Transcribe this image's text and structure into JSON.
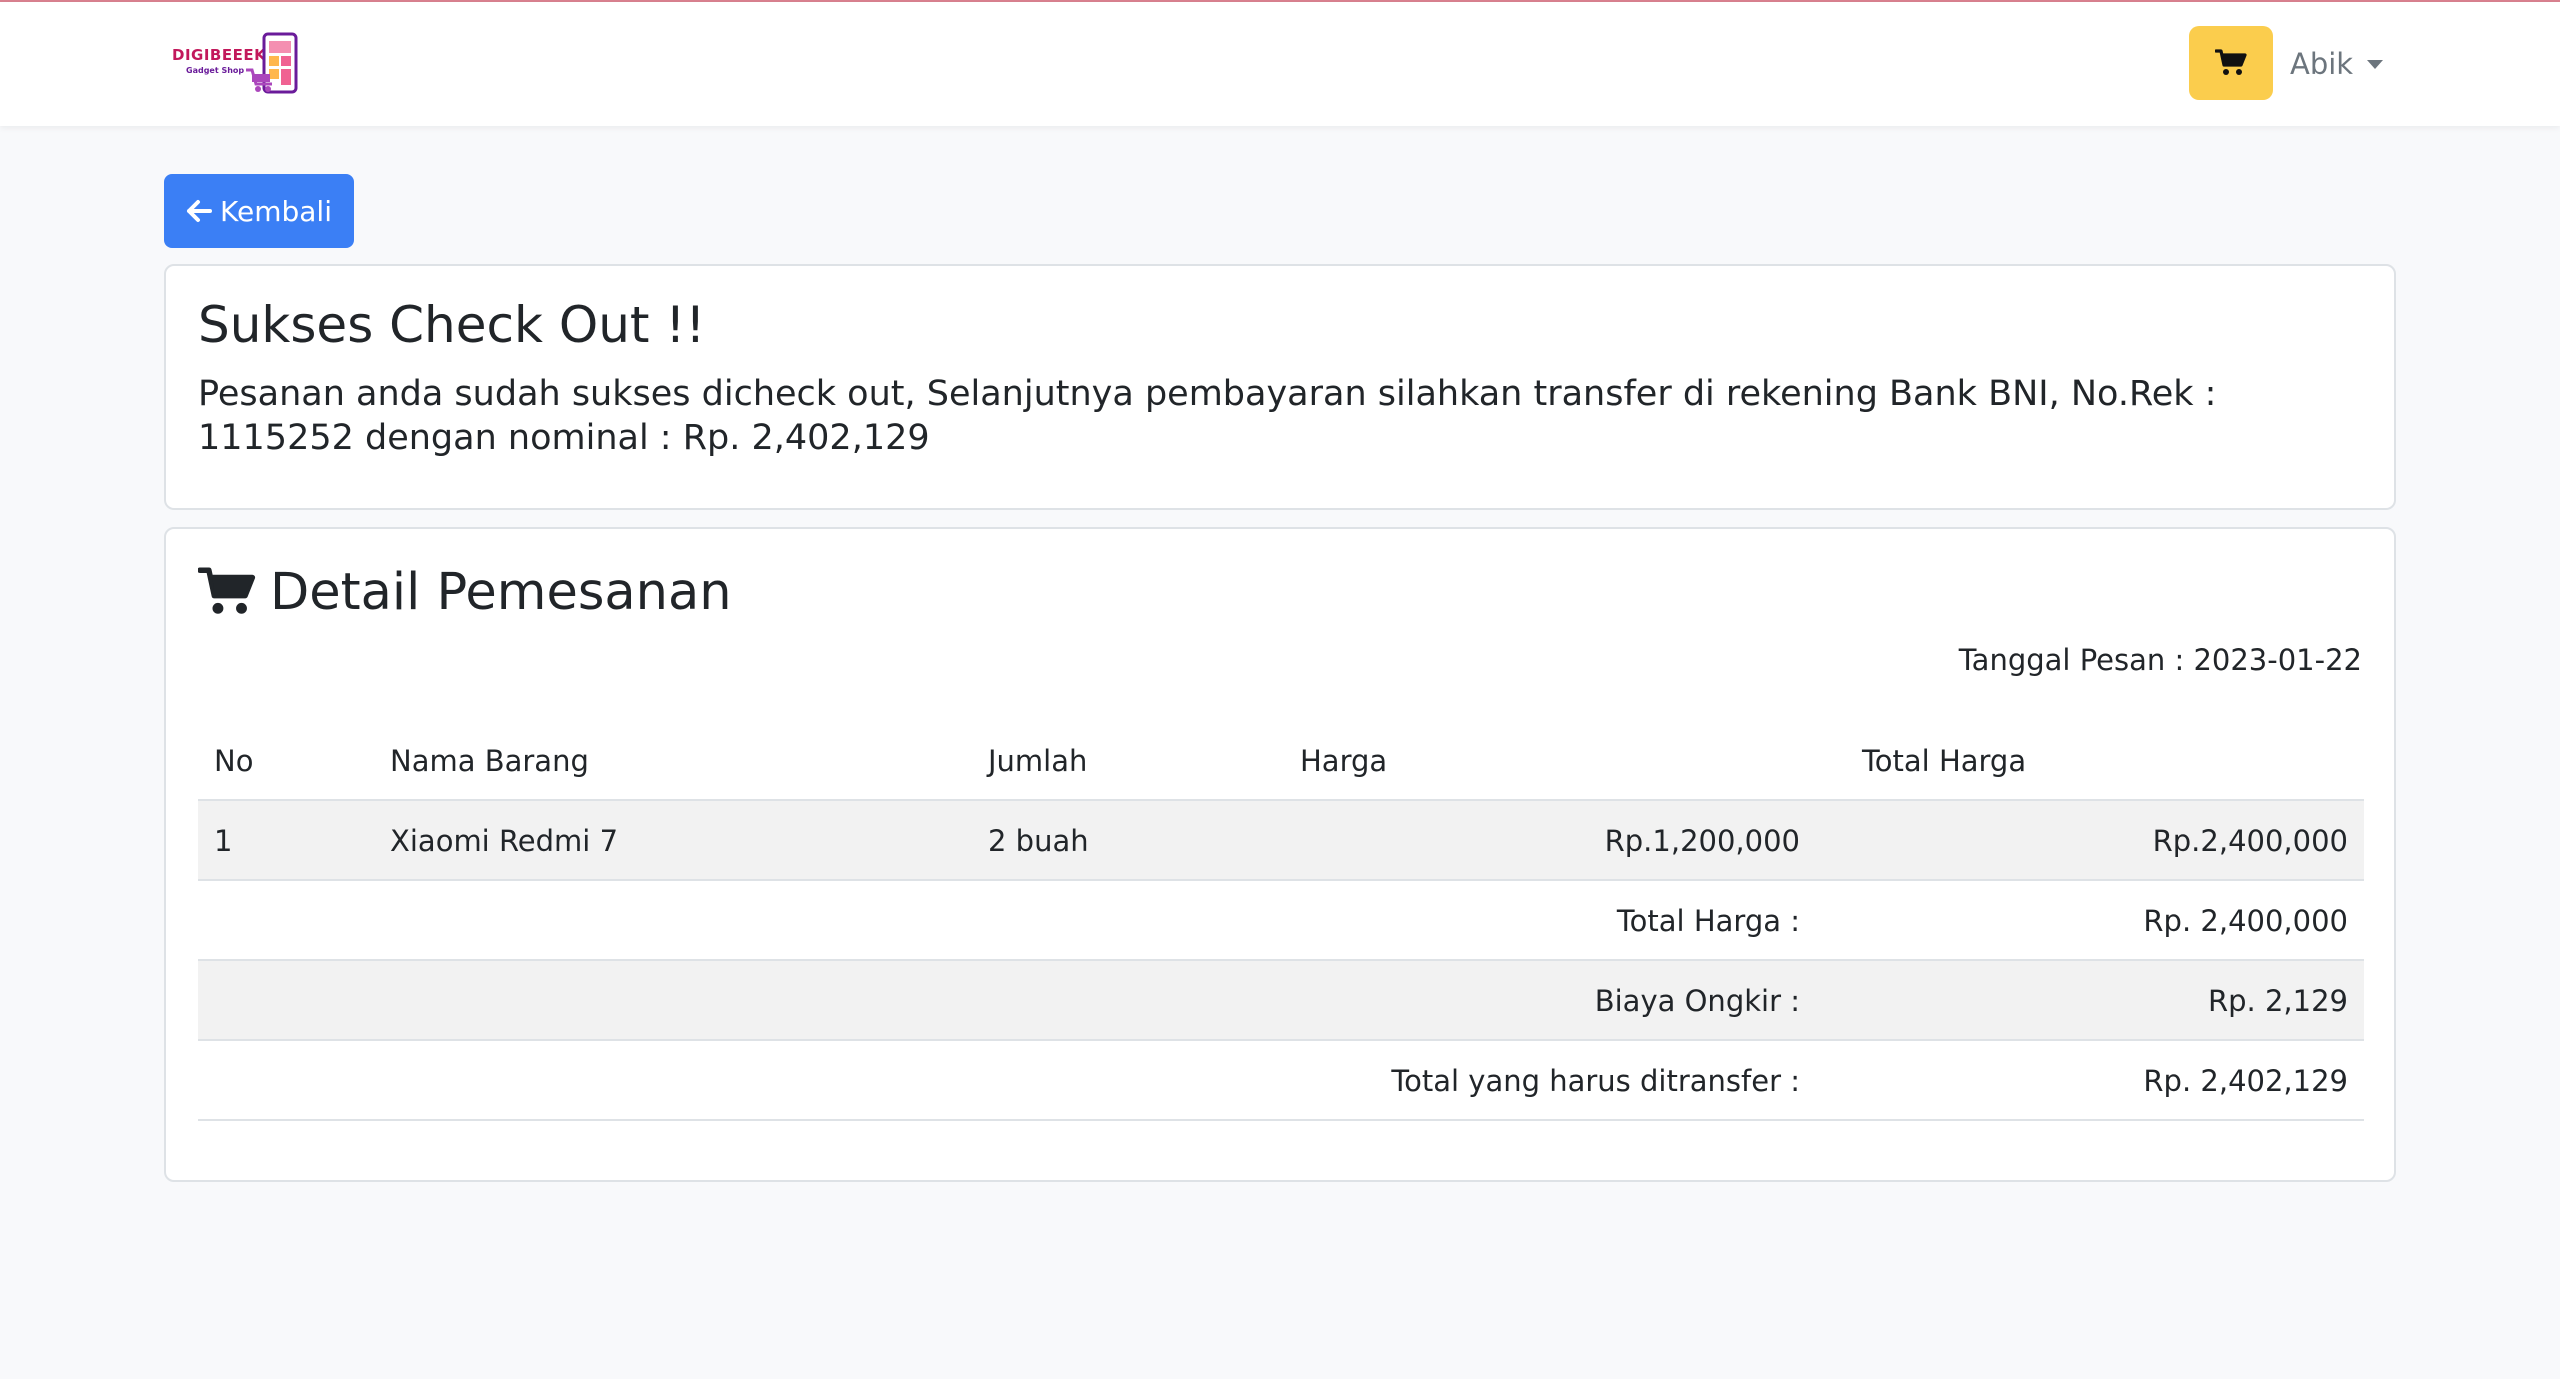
{
  "header": {
    "logo": {
      "brand": "DIGIBEEEK",
      "tagline": "Gadget Shop"
    },
    "cart_icon": "cart-icon",
    "user_name": "Abik"
  },
  "back_button": {
    "label": "Kembali",
    "icon": "arrow-left-icon"
  },
  "success_card": {
    "title": "Sukses Check Out !!",
    "message": "Pesanan anda sudah sukses dicheck out, Selanjutnya pembayaran silahkan transfer di rekening Bank BNI, No.Rek : 1115252 dengan nominal : Rp. 2,402,129"
  },
  "detail_card": {
    "title": "Detail Pemesanan",
    "icon": "cart-icon",
    "order_date": "Tanggal Pesan : 2023-01-22",
    "table": {
      "headers": {
        "no": "No",
        "name": "Nama Barang",
        "qty": "Jumlah",
        "price": "Harga",
        "total": "Total Harga"
      },
      "items": [
        {
          "no": "1",
          "name": "Xiaomi Redmi 7",
          "qty": "2 buah",
          "price": "Rp.1,200,000",
          "total": "Rp.2,400,000"
        }
      ],
      "summary": [
        {
          "label": "Total Harga :",
          "value": "Rp. 2,400,000"
        },
        {
          "label": "Biaya Ongkir :",
          "value": "Rp. 2,129"
        },
        {
          "label": "Total yang harus ditransfer :",
          "value": "Rp. 2,402,129"
        }
      ]
    }
  },
  "colors": {
    "accent_blue": "#3b7ff5",
    "cart_yellow": "#fbcd4d",
    "brand_pink": "#c2185b"
  }
}
